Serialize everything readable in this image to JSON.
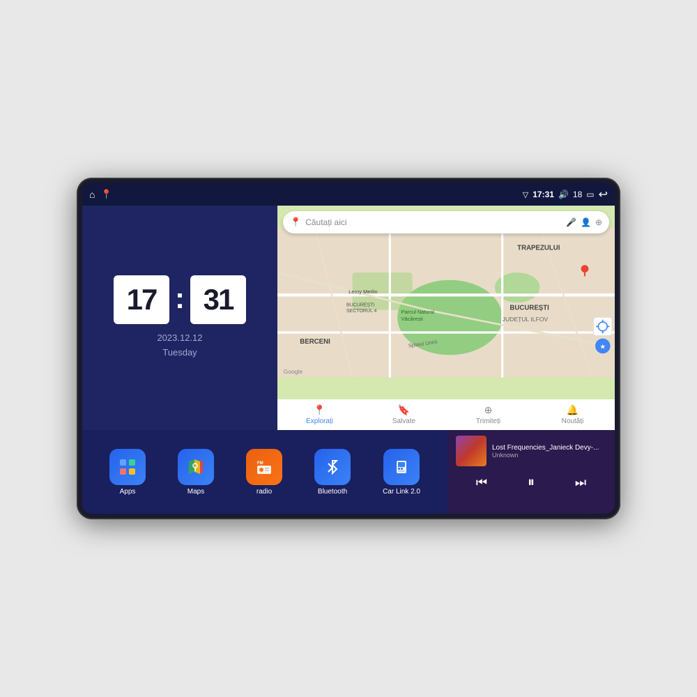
{
  "device": {
    "status_bar": {
      "signal_icon": "▽",
      "time": "17:31",
      "volume_icon": "🔊",
      "battery_level": "18",
      "battery_icon": "🔋",
      "back_icon": "↩"
    },
    "nav_icons": {
      "home": "⌂",
      "maps_pin": "📍"
    }
  },
  "clock_widget": {
    "hour": "17",
    "minute": "31",
    "date": "2023.12.12",
    "day": "Tuesday"
  },
  "map_widget": {
    "search_placeholder": "Căutați aici",
    "nav_items": [
      {
        "label": "Explorați",
        "active": true
      },
      {
        "label": "Salvate",
        "active": false
      },
      {
        "label": "Trimiteți",
        "active": false
      },
      {
        "label": "Noutăți",
        "active": false
      }
    ],
    "labels": [
      "TRAPEZULUI",
      "BUCUREȘTI",
      "JUDEȚUL ILFOV",
      "BERCENI",
      "Parcul Natural Văcărești",
      "Leroy Merlin",
      "BUCUREȘTI SECTORUL 4",
      "Splaiul Unirii"
    ]
  },
  "app_icons": [
    {
      "label": "Apps",
      "bg_color": "#3b82f6",
      "icon": "⊞"
    },
    {
      "label": "Maps",
      "bg_color": "#3b82f6",
      "icon": "🗺"
    },
    {
      "label": "radio",
      "bg_color": "#f97316",
      "icon": "📻"
    },
    {
      "label": "Bluetooth",
      "bg_color": "#3b82f6",
      "icon": "🔷"
    },
    {
      "label": "Car Link 2.0",
      "bg_color": "#3b82f6",
      "icon": "📱"
    }
  ],
  "music_player": {
    "title": "Lost Frequencies_Janieck Devy-...",
    "artist": "Unknown",
    "prev_icon": "⏮",
    "play_icon": "⏸",
    "next_icon": "⏭"
  }
}
